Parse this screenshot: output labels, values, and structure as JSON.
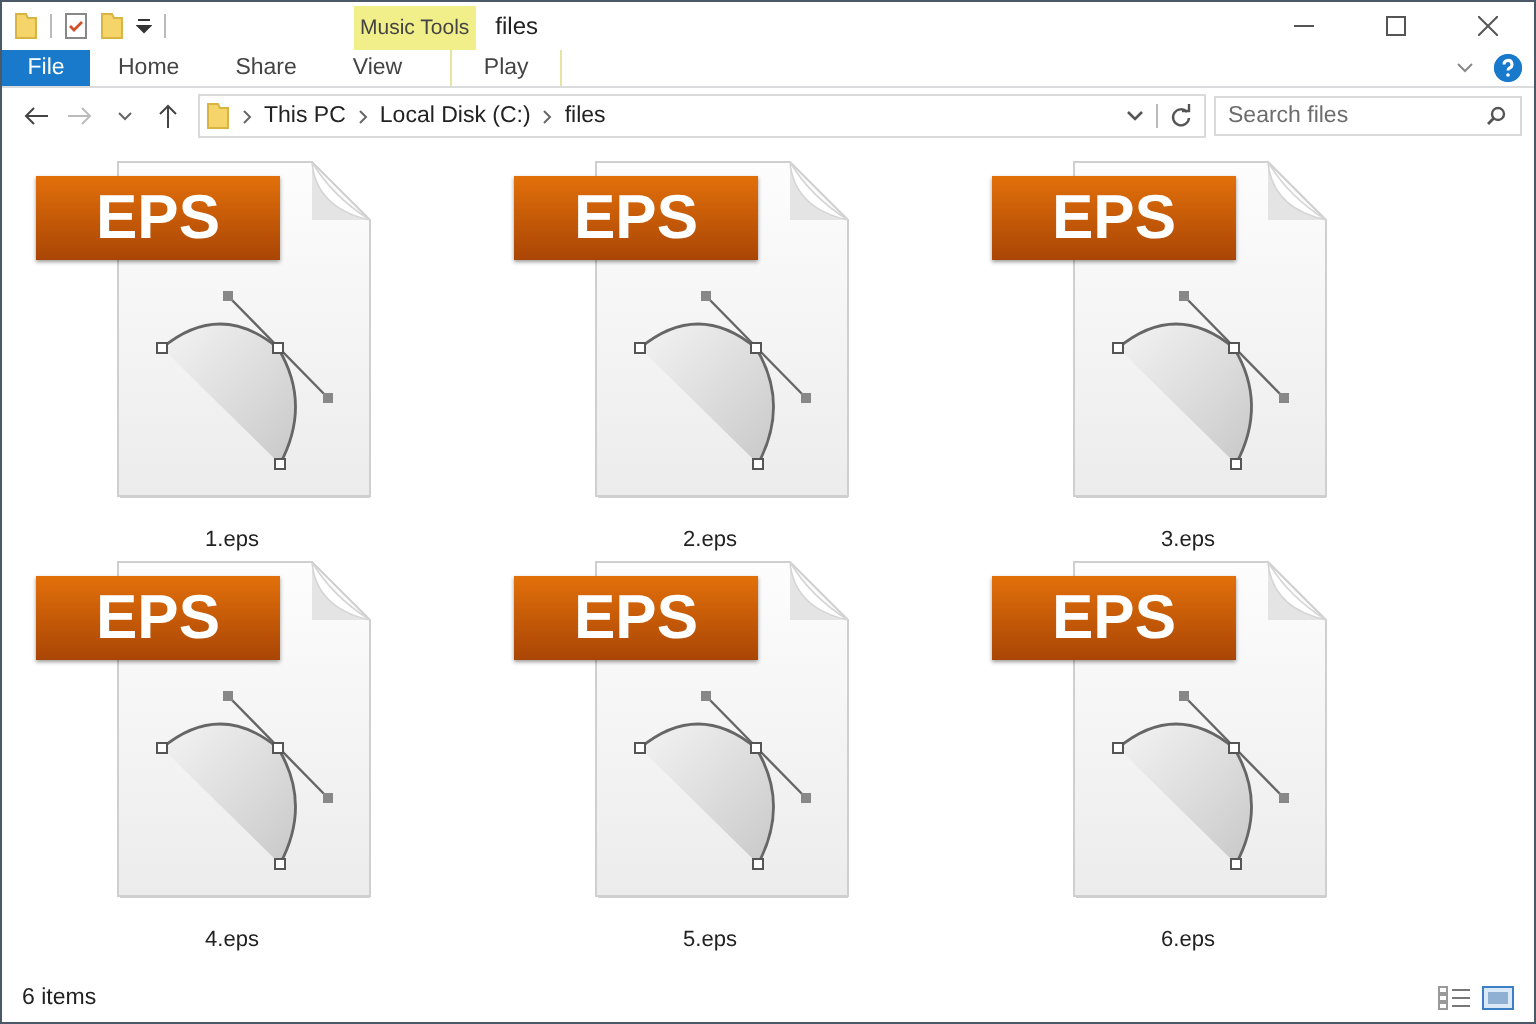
{
  "window": {
    "title": "files"
  },
  "context_group": {
    "label": "Music Tools"
  },
  "ribbon_tabs": [
    {
      "label": "File",
      "kind": "file"
    },
    {
      "label": "Home",
      "kind": "tab"
    },
    {
      "label": "Share",
      "kind": "tab"
    },
    {
      "label": "View",
      "kind": "tab"
    },
    {
      "label": "Play",
      "kind": "contextual"
    }
  ],
  "address": {
    "path": [
      "This PC",
      "Local Disk (C:)",
      "files"
    ]
  },
  "search": {
    "placeholder": "Search files"
  },
  "files": [
    {
      "name": "1.eps",
      "badge": "EPS"
    },
    {
      "name": "2.eps",
      "badge": "EPS"
    },
    {
      "name": "3.eps",
      "badge": "EPS"
    },
    {
      "name": "4.eps",
      "badge": "EPS"
    },
    {
      "name": "5.eps",
      "badge": "EPS"
    },
    {
      "name": "6.eps",
      "badge": "EPS"
    }
  ],
  "status_bar": {
    "count": "6 items"
  }
}
